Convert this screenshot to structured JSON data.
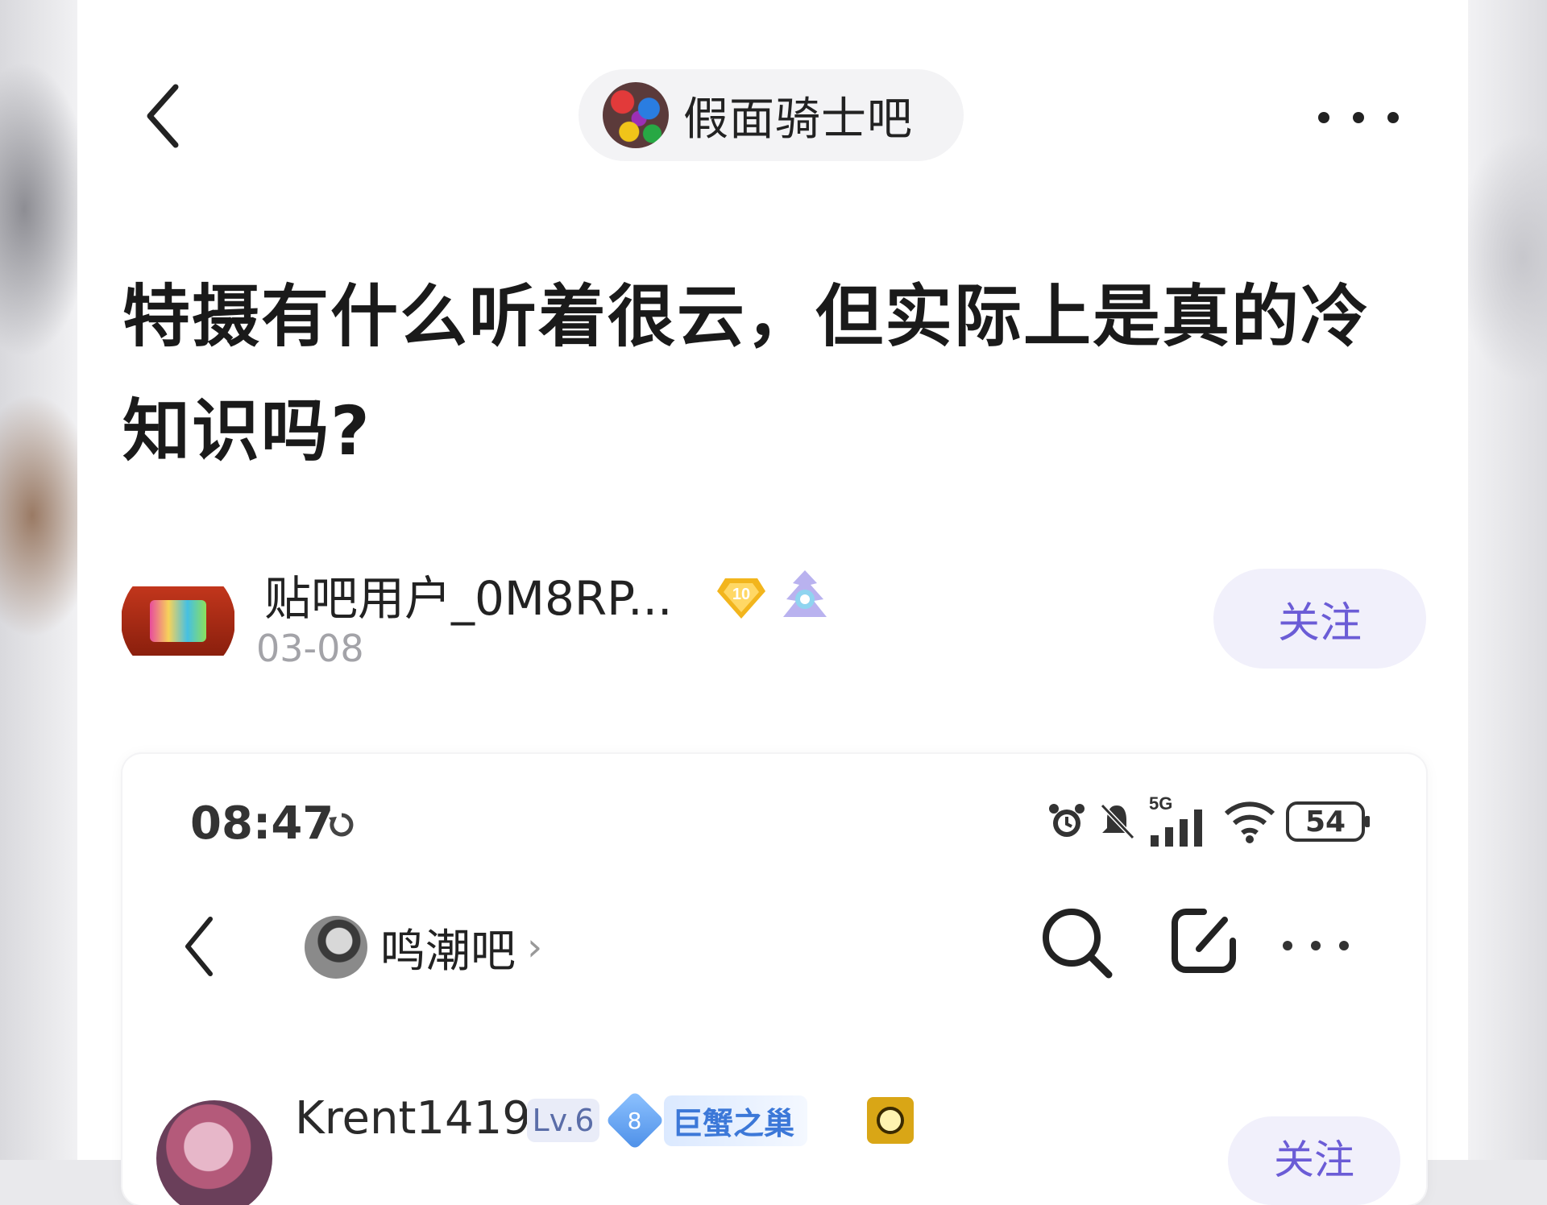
{
  "header": {
    "forum_name": "假面骑士吧",
    "back_icon": "chevron-left-icon",
    "more_icon": "more-horizontal-icon"
  },
  "post": {
    "title": "特摄有什么听着很云，但实际上是真的冷知识吗?",
    "author": {
      "name": "贴吧用户_0M8RP...",
      "level": "10",
      "date": "03-08"
    },
    "follow_label": "关注"
  },
  "screenshot": {
    "status": {
      "time": "08:47",
      "network": "5G",
      "battery": "54"
    },
    "nav": {
      "forum_name": "鸣潮吧",
      "chevron": "›"
    },
    "reply": {
      "user": "Krent1419",
      "level_badge": "Lv.6",
      "fan_level": "8",
      "fan_tag": "巨蟹之巢",
      "follow_label": "关注"
    }
  },
  "colors": {
    "accent": "#6b5cd6",
    "follow_bg": "#f1f0fb",
    "date_gray": "#a3a3a8"
  }
}
